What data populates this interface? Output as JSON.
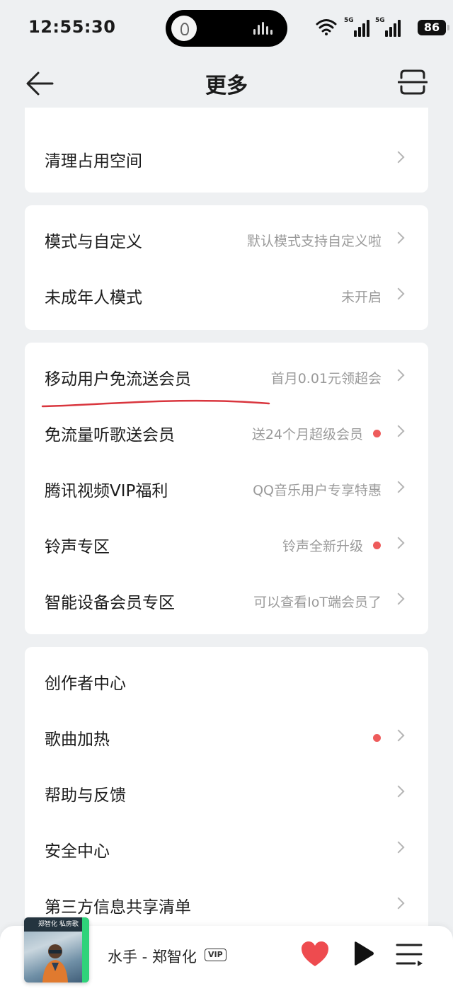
{
  "status_bar": {
    "time": "12:55:30",
    "network1": "5G",
    "network2": "5G",
    "battery": "86"
  },
  "header": {
    "title": "更多",
    "back_icon": "arrow-left-icon",
    "scan_icon": "scan-icon"
  },
  "sections": [
    {
      "items": [
        {
          "label": "清理占用空间",
          "hint": "",
          "dot": false
        }
      ]
    },
    {
      "items": [
        {
          "label": "模式与自定义",
          "hint": "默认模式支持自定义啦",
          "dot": false
        },
        {
          "label": "未成年人模式",
          "hint": "未开启",
          "dot": false
        }
      ]
    },
    {
      "items": [
        {
          "label": "移动用户免流送会员",
          "hint": "首月0.01元领超会",
          "dot": false
        },
        {
          "label": "免流量听歌送会员",
          "hint": "送24个月超级会员",
          "dot": true
        },
        {
          "label": "腾讯视频VIP福利",
          "hint": "QQ音乐用户专享特惠",
          "dot": false
        },
        {
          "label": "铃声专区",
          "hint": "铃声全新升级",
          "dot": true
        },
        {
          "label": "智能设备会员专区",
          "hint": "可以查看IoT端会员了",
          "dot": false
        }
      ]
    },
    {
      "items": [
        {
          "label": "创作者中心",
          "hint": "",
          "dot": false,
          "chevron": false
        },
        {
          "label": "歌曲加热",
          "hint": "",
          "dot": true
        },
        {
          "label": "帮助与反馈",
          "hint": "",
          "dot": false
        },
        {
          "label": "安全中心",
          "hint": "",
          "dot": false
        },
        {
          "label": "第三方信息共享清单",
          "hint": "",
          "dot": false
        }
      ]
    }
  ],
  "player": {
    "song": "水手 - 郑智化",
    "badge": "VIP",
    "cover_text": "郑智化 私房歌",
    "icons": [
      "heart-icon",
      "play-icon",
      "playlist-icon"
    ],
    "heart_color": "#ee4b4f"
  },
  "colors": {
    "background": "#eef0f2",
    "red_dot": "#ee5b5b",
    "annotation_underline": "#d9363e"
  }
}
